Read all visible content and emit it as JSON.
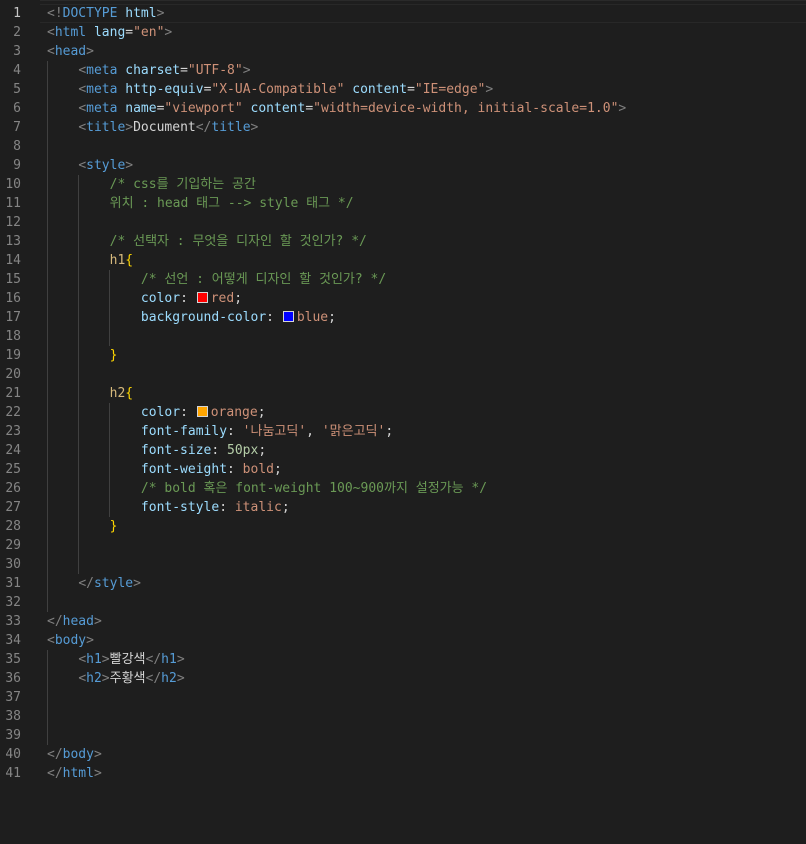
{
  "editor": {
    "active_line": 1,
    "line_numbers": [
      "1",
      "2",
      "3",
      "4",
      "5",
      "6",
      "7",
      "8",
      "9",
      "10",
      "11",
      "12",
      "13",
      "14",
      "15",
      "16",
      "17",
      "18",
      "19",
      "20",
      "21",
      "22",
      "23",
      "24",
      "25",
      "26",
      "27",
      "28",
      "29",
      "30",
      "31",
      "32",
      "33",
      "34",
      "35",
      "36",
      "37",
      "38",
      "39",
      "40",
      "41"
    ],
    "colors": {
      "red_swatch": "#ff0000",
      "blue_swatch": "#0000ff",
      "orange_swatch": "#ffa500"
    },
    "lines": [
      [
        {
          "c": "t-br",
          "t": "<!"
        },
        {
          "c": "t-tag",
          "t": "DOCTYPE"
        },
        {
          "c": "t-text",
          "t": " "
        },
        {
          "c": "t-attr",
          "t": "html"
        },
        {
          "c": "t-br",
          "t": ">"
        }
      ],
      [
        {
          "c": "t-br",
          "t": "<"
        },
        {
          "c": "t-tag",
          "t": "html"
        },
        {
          "c": "t-text",
          "t": " "
        },
        {
          "c": "t-attr",
          "t": "lang"
        },
        {
          "c": "t-text",
          "t": "="
        },
        {
          "c": "t-str",
          "t": "\"en\""
        },
        {
          "c": "t-br",
          "t": ">"
        }
      ],
      [
        {
          "c": "t-br",
          "t": "<"
        },
        {
          "c": "t-tag",
          "t": "head"
        },
        {
          "c": "t-br",
          "t": ">"
        }
      ],
      [
        {
          "c": "t-text",
          "t": "    "
        },
        {
          "c": "t-br",
          "t": "<"
        },
        {
          "c": "t-tag",
          "t": "meta"
        },
        {
          "c": "t-text",
          "t": " "
        },
        {
          "c": "t-attr",
          "t": "charset"
        },
        {
          "c": "t-text",
          "t": "="
        },
        {
          "c": "t-str",
          "t": "\"UTF-8\""
        },
        {
          "c": "t-br",
          "t": ">"
        }
      ],
      [
        {
          "c": "t-text",
          "t": "    "
        },
        {
          "c": "t-br",
          "t": "<"
        },
        {
          "c": "t-tag",
          "t": "meta"
        },
        {
          "c": "t-text",
          "t": " "
        },
        {
          "c": "t-attr",
          "t": "http-equiv"
        },
        {
          "c": "t-text",
          "t": "="
        },
        {
          "c": "t-str",
          "t": "\"X-UA-Compatible\""
        },
        {
          "c": "t-text",
          "t": " "
        },
        {
          "c": "t-attr",
          "t": "content"
        },
        {
          "c": "t-text",
          "t": "="
        },
        {
          "c": "t-str",
          "t": "\"IE=edge\""
        },
        {
          "c": "t-br",
          "t": ">"
        }
      ],
      [
        {
          "c": "t-text",
          "t": "    "
        },
        {
          "c": "t-br",
          "t": "<"
        },
        {
          "c": "t-tag",
          "t": "meta"
        },
        {
          "c": "t-text",
          "t": " "
        },
        {
          "c": "t-attr",
          "t": "name"
        },
        {
          "c": "t-text",
          "t": "="
        },
        {
          "c": "t-str",
          "t": "\"viewport\""
        },
        {
          "c": "t-text",
          "t": " "
        },
        {
          "c": "t-attr",
          "t": "content"
        },
        {
          "c": "t-text",
          "t": "="
        },
        {
          "c": "t-str",
          "t": "\"width=device-width, initial-scale=1.0\""
        },
        {
          "c": "t-br",
          "t": ">"
        }
      ],
      [
        {
          "c": "t-text",
          "t": "    "
        },
        {
          "c": "t-br",
          "t": "<"
        },
        {
          "c": "t-tag",
          "t": "title"
        },
        {
          "c": "t-br",
          "t": ">"
        },
        {
          "c": "t-text",
          "t": "Document"
        },
        {
          "c": "t-br",
          "t": "</"
        },
        {
          "c": "t-tag",
          "t": "title"
        },
        {
          "c": "t-br",
          "t": ">"
        }
      ],
      [],
      [
        {
          "c": "t-text",
          "t": "    "
        },
        {
          "c": "t-br",
          "t": "<"
        },
        {
          "c": "t-tag",
          "t": "style"
        },
        {
          "c": "t-br",
          "t": ">"
        }
      ],
      [
        {
          "c": "t-text",
          "t": "        "
        },
        {
          "c": "t-com",
          "t": "/* css를 기입하는 공간"
        }
      ],
      [
        {
          "c": "t-text",
          "t": "        "
        },
        {
          "c": "t-com",
          "t": "위치 : head 태그 --> style 태그 */"
        }
      ],
      [],
      [
        {
          "c": "t-text",
          "t": "        "
        },
        {
          "c": "t-com",
          "t": "/* 선택자 : 무엇을 디자인 할 것인가? */"
        }
      ],
      [
        {
          "c": "t-text",
          "t": "        "
        },
        {
          "c": "t-sel",
          "t": "h1"
        },
        {
          "c": "t-brace",
          "t": "{"
        }
      ],
      [
        {
          "c": "t-text",
          "t": "            "
        },
        {
          "c": "t-com",
          "t": "/* 선언 : 어떻게 디자인 할 것인가? */"
        }
      ],
      [
        {
          "c": "t-text",
          "t": "            "
        },
        {
          "c": "t-prop",
          "t": "color"
        },
        {
          "c": "t-punct",
          "t": ": "
        },
        {
          "sw": "red_swatch"
        },
        {
          "c": "t-val",
          "t": "red"
        },
        {
          "c": "t-punct",
          "t": ";"
        }
      ],
      [
        {
          "c": "t-text",
          "t": "            "
        },
        {
          "c": "t-prop",
          "t": "background-color"
        },
        {
          "c": "t-punct",
          "t": ": "
        },
        {
          "sw": "blue_swatch"
        },
        {
          "c": "t-val",
          "t": "blue"
        },
        {
          "c": "t-punct",
          "t": ";"
        }
      ],
      [],
      [
        {
          "c": "t-text",
          "t": "        "
        },
        {
          "c": "t-brace",
          "t": "}"
        }
      ],
      [],
      [
        {
          "c": "t-text",
          "t": "        "
        },
        {
          "c": "t-sel",
          "t": "h2"
        },
        {
          "c": "t-brace",
          "t": "{"
        }
      ],
      [
        {
          "c": "t-text",
          "t": "            "
        },
        {
          "c": "t-prop",
          "t": "color"
        },
        {
          "c": "t-punct",
          "t": ": "
        },
        {
          "sw": "orange_swatch"
        },
        {
          "c": "t-val",
          "t": "orange"
        },
        {
          "c": "t-punct",
          "t": ";"
        }
      ],
      [
        {
          "c": "t-text",
          "t": "            "
        },
        {
          "c": "t-prop",
          "t": "font-family"
        },
        {
          "c": "t-punct",
          "t": ": "
        },
        {
          "c": "t-val",
          "t": "'나눔고딕'"
        },
        {
          "c": "t-punct",
          "t": ", "
        },
        {
          "c": "t-val",
          "t": "'맑은고딕'"
        },
        {
          "c": "t-punct",
          "t": ";"
        }
      ],
      [
        {
          "c": "t-text",
          "t": "            "
        },
        {
          "c": "t-prop",
          "t": "font-size"
        },
        {
          "c": "t-punct",
          "t": ": "
        },
        {
          "c": "t-num",
          "t": "50px"
        },
        {
          "c": "t-punct",
          "t": ";"
        }
      ],
      [
        {
          "c": "t-text",
          "t": "            "
        },
        {
          "c": "t-prop",
          "t": "font-weight"
        },
        {
          "c": "t-punct",
          "t": ": "
        },
        {
          "c": "t-val",
          "t": "bold"
        },
        {
          "c": "t-punct",
          "t": ";"
        }
      ],
      [
        {
          "c": "t-text",
          "t": "            "
        },
        {
          "c": "t-com",
          "t": "/* bold 혹은 font-weight 100~900까지 설정가능 */"
        }
      ],
      [
        {
          "c": "t-text",
          "t": "            "
        },
        {
          "c": "t-prop",
          "t": "font-style"
        },
        {
          "c": "t-punct",
          "t": ": "
        },
        {
          "c": "t-val",
          "t": "italic"
        },
        {
          "c": "t-punct",
          "t": ";"
        }
      ],
      [
        {
          "c": "t-text",
          "t": "        "
        },
        {
          "c": "t-brace",
          "t": "}"
        }
      ],
      [],
      [],
      [
        {
          "c": "t-text",
          "t": "    "
        },
        {
          "c": "t-br",
          "t": "</"
        },
        {
          "c": "t-tag",
          "t": "style"
        },
        {
          "c": "t-br",
          "t": ">"
        }
      ],
      [],
      [
        {
          "c": "t-br",
          "t": "</"
        },
        {
          "c": "t-tag",
          "t": "head"
        },
        {
          "c": "t-br",
          "t": ">"
        }
      ],
      [
        {
          "c": "t-br",
          "t": "<"
        },
        {
          "c": "t-tag",
          "t": "body"
        },
        {
          "c": "t-br",
          "t": ">"
        }
      ],
      [
        {
          "c": "t-text",
          "t": "    "
        },
        {
          "c": "t-br",
          "t": "<"
        },
        {
          "c": "t-tag",
          "t": "h1"
        },
        {
          "c": "t-br",
          "t": ">"
        },
        {
          "c": "t-text",
          "t": "빨강색"
        },
        {
          "c": "t-br",
          "t": "</"
        },
        {
          "c": "t-tag",
          "t": "h1"
        },
        {
          "c": "t-br",
          "t": ">"
        }
      ],
      [
        {
          "c": "t-text",
          "t": "    "
        },
        {
          "c": "t-br",
          "t": "<"
        },
        {
          "c": "t-tag",
          "t": "h2"
        },
        {
          "c": "t-br",
          "t": ">"
        },
        {
          "c": "t-text",
          "t": "주황색"
        },
        {
          "c": "t-br",
          "t": "</"
        },
        {
          "c": "t-tag",
          "t": "h2"
        },
        {
          "c": "t-br",
          "t": ">"
        }
      ],
      [],
      [],
      [],
      [
        {
          "c": "t-br",
          "t": "</"
        },
        {
          "c": "t-tag",
          "t": "body"
        },
        {
          "c": "t-br",
          "t": ">"
        }
      ],
      [
        {
          "c": "t-br",
          "t": "</"
        },
        {
          "c": "t-tag",
          "t": "html"
        },
        {
          "c": "t-br",
          "t": ">"
        }
      ]
    ]
  }
}
